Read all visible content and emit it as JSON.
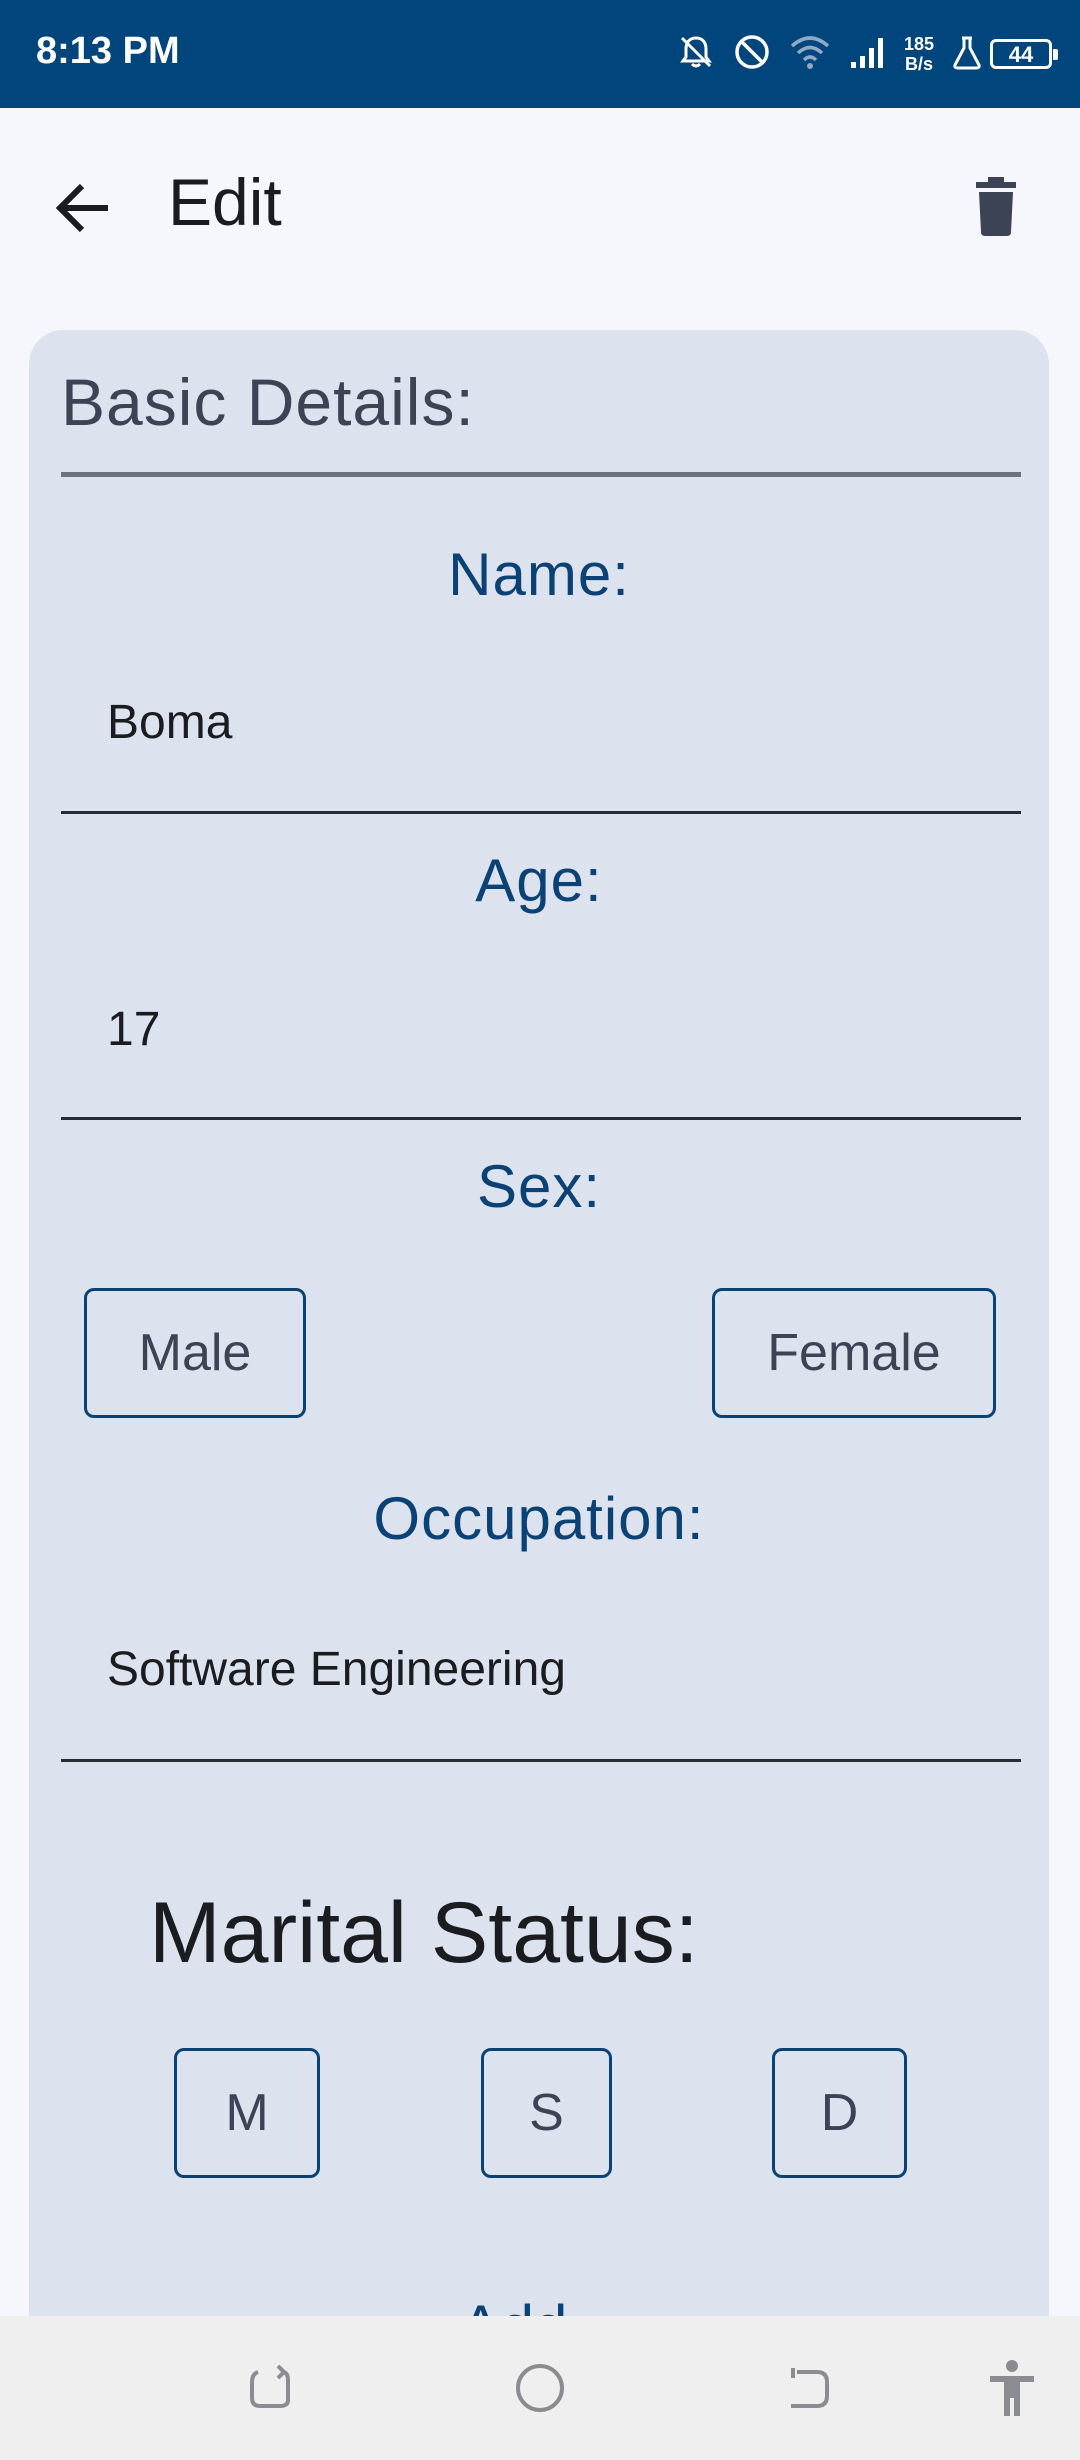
{
  "status_bar": {
    "time": "8:13 PM",
    "net_speed_value": "185",
    "net_speed_unit": "B/s",
    "battery": "44",
    "icons": [
      "bell-off-icon",
      "do-not-disturb-icon",
      "wifi-icon",
      "signal-icon",
      "lab-flask-icon",
      "battery-icon"
    ]
  },
  "app_bar": {
    "title": "Edit",
    "back_icon": "arrow-left-icon",
    "delete_icon": "trash-icon"
  },
  "card": {
    "section_title": "Basic Details:",
    "name": {
      "label": "Name:",
      "value": "Boma"
    },
    "age": {
      "label": "Age:",
      "value": "17"
    },
    "sex": {
      "label": "Sex:",
      "options": [
        "Male",
        "Female"
      ]
    },
    "occupation": {
      "label": "Occupation:",
      "value": "Software Engineering"
    },
    "marital": {
      "label": "Marital Status:",
      "options": [
        "M",
        "S",
        "D"
      ]
    },
    "address_peek": "Add..."
  },
  "colors": {
    "status_bar": "#00457c",
    "accent": "#0b4276",
    "card_bg": "#dce2ee",
    "page_bg": "#f5f7fc"
  },
  "nav_bar": {
    "icons": [
      "recent-apps-icon",
      "home-icon",
      "back-nav-icon",
      "accessibility-icon"
    ]
  }
}
